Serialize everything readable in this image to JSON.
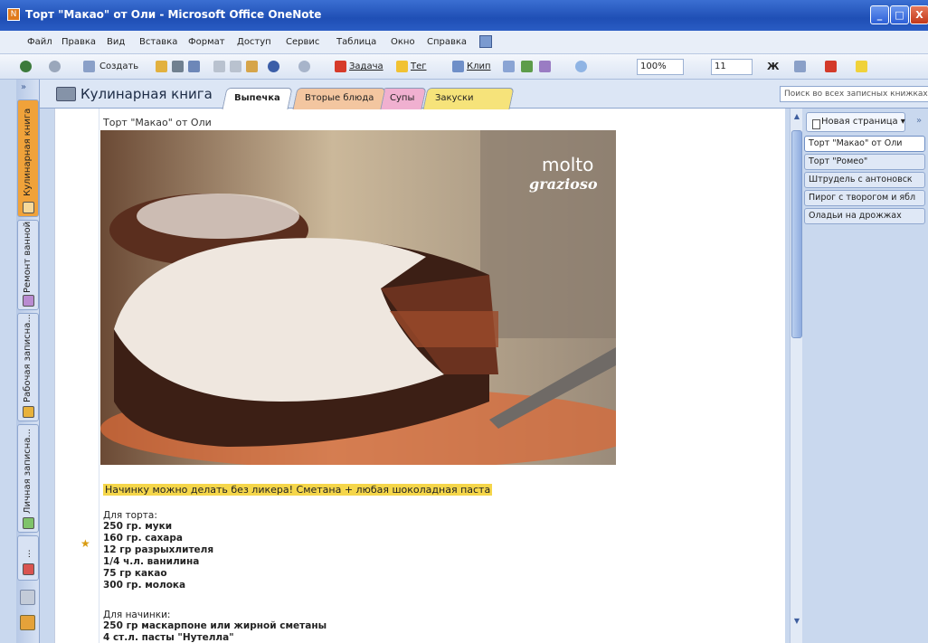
{
  "window": {
    "title": "Торт \"Макао\" от Оли - Microsoft Office OneNote",
    "minimize": "_",
    "maximize": "□",
    "close": "X"
  },
  "menu": [
    "Файл",
    "Правка",
    "Вид",
    "Вставка",
    "Формат",
    "Доступ",
    "Сервис",
    "Таблица",
    "Окно",
    "Справка"
  ],
  "toolbar": {
    "create": "Создать",
    "task": "Задача",
    "tag": "Тег",
    "clip": "Клип",
    "zoom": "100%",
    "font_size": "11",
    "bold": "Ж"
  },
  "notebooks": [
    {
      "label": "Кулинарная книга",
      "color": "#f0a23a"
    },
    {
      "label": "Ремонт ванной",
      "color": "#b98bd1"
    },
    {
      "label": "Рабочая записна...",
      "color": "#e8b23c"
    },
    {
      "label": "Личная записна...",
      "color": "#7fc36b"
    },
    {
      "label": "...",
      "color": "#d9534f"
    }
  ],
  "header": {
    "notebook_name": "Кулинарная книга",
    "search_placeholder": "Поиск во всех записных книжках"
  },
  "sections": [
    {
      "label": "Выпечка",
      "color": "#ffffff",
      "active": true
    },
    {
      "label": "Вторые блюда",
      "color": "#f3c6a0"
    },
    {
      "label": "Супы",
      "color": "#f0b0d0"
    },
    {
      "label": "Закуски",
      "color": "#f6e37a"
    }
  ],
  "page": {
    "title": "Торт \"Макао\" от Оли",
    "watermark_line1": "molto",
    "watermark_line2": "grazioso",
    "highlight": "Начинку можно делать без ликера! Сметана + любая шоколадная паста",
    "cake_heading": "Для торта:",
    "cake_items": [
      "250 гр. муки",
      "160 гр. сахара",
      "12 гр разрыхлителя",
      "1/4 ч.л. ванилина",
      "75 гр какао",
      "300 гр. молока"
    ],
    "filling_heading": "Для начинки:",
    "filling_items": [
      "250 гр маскарпоне или жирной сметаны",
      "4 ст.л. пасты \"Нутелла\""
    ]
  },
  "pages_panel": {
    "new_page": "Новая страница",
    "more": "»",
    "items": [
      "Торт \"Макао\" от Оли",
      "Торт \"Ромео\"",
      "Штрудель с антоновск",
      "Пирог с творогом и ябл",
      "Оладьи на дрожжах"
    ]
  }
}
